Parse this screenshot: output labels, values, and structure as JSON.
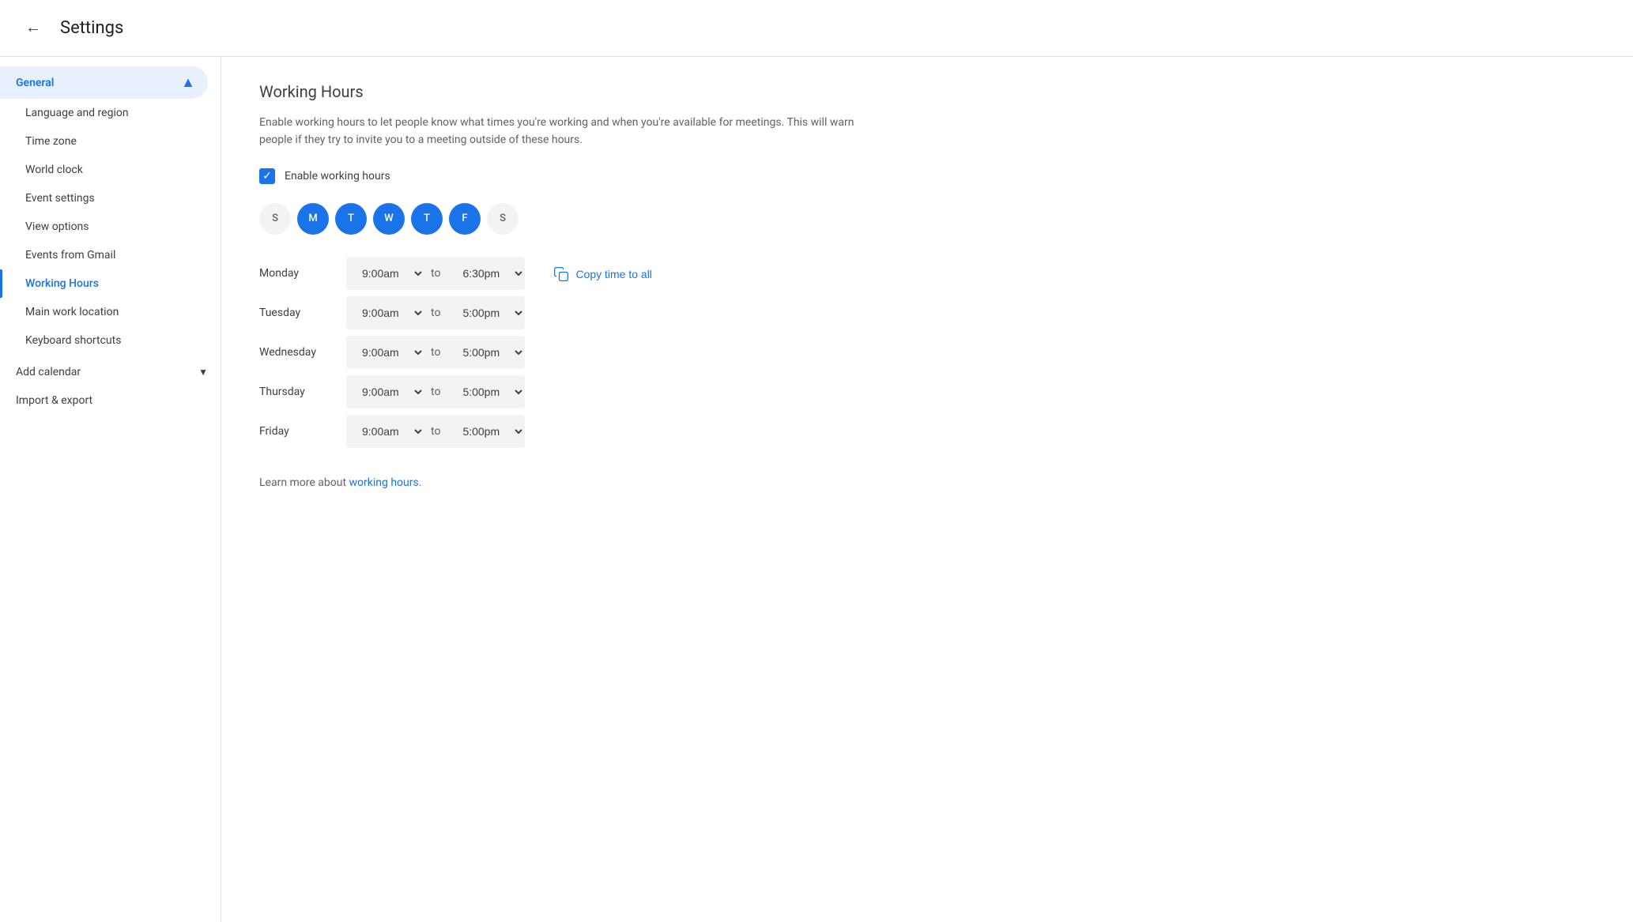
{
  "header": {
    "back_label": "←",
    "title": "Settings"
  },
  "sidebar": {
    "general_label": "General",
    "items": [
      {
        "id": "language-region",
        "label": "Language and region",
        "active": false
      },
      {
        "id": "time-zone",
        "label": "Time zone",
        "active": false
      },
      {
        "id": "world-clock",
        "label": "World clock",
        "active": false
      },
      {
        "id": "event-settings",
        "label": "Event settings",
        "active": false
      },
      {
        "id": "view-options",
        "label": "View options",
        "active": false
      },
      {
        "id": "events-from-gmail",
        "label": "Events from Gmail",
        "active": false
      },
      {
        "id": "working-hours",
        "label": "Working Hours",
        "active": true
      },
      {
        "id": "main-work-location",
        "label": "Main work location",
        "active": false
      },
      {
        "id": "keyboard-shortcuts",
        "label": "Keyboard shortcuts",
        "active": false
      }
    ],
    "add_calendar_label": "Add calendar",
    "import_export_label": "Import & export"
  },
  "main": {
    "title": "Working Hours",
    "description": "Enable working hours to let people know what times you're working and when you're available for meetings. This will warn people if they try to invite you to a meeting outside of these hours.",
    "enable_checkbox_label": "Enable working hours",
    "enable_checkbox_checked": true,
    "days": [
      {
        "letter": "S",
        "active": false
      },
      {
        "letter": "M",
        "active": true
      },
      {
        "letter": "T",
        "active": true
      },
      {
        "letter": "W",
        "active": true
      },
      {
        "letter": "T",
        "active": true
      },
      {
        "letter": "F",
        "active": true
      },
      {
        "letter": "S",
        "active": false
      }
    ],
    "time_rows": [
      {
        "day": "Monday",
        "start": "9:00am",
        "end": "6:30pm"
      },
      {
        "day": "Tuesday",
        "start": "9:00am",
        "end": "5:00pm"
      },
      {
        "day": "Wednesday",
        "start": "9:00am",
        "end": "5:00pm"
      },
      {
        "day": "Thursday",
        "start": "9:00am",
        "end": "5:00pm"
      },
      {
        "day": "Friday",
        "start": "9:00am",
        "end": "5:00pm"
      }
    ],
    "copy_time_label": "Copy time to all",
    "learn_more_text": "Learn more about ",
    "learn_more_link": "working hours.",
    "to_label": "to"
  },
  "icons": {
    "back": "←",
    "chevron_up": "▲",
    "chevron_down": "▼",
    "check": "✓",
    "copy": "⧉"
  }
}
